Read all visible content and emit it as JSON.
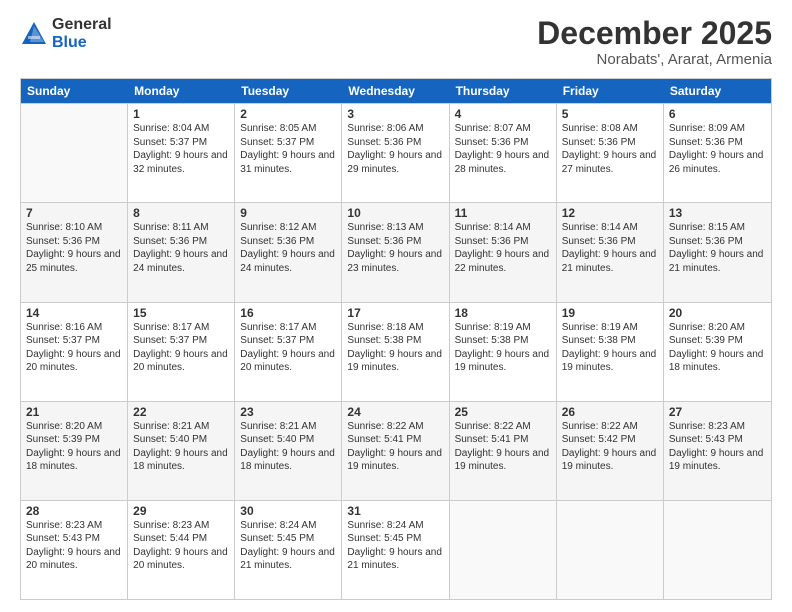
{
  "logo": {
    "general": "General",
    "blue": "Blue"
  },
  "title": "December 2025",
  "location": "Norabats', Ararat, Armenia",
  "days": [
    "Sunday",
    "Monday",
    "Tuesday",
    "Wednesday",
    "Thursday",
    "Friday",
    "Saturday"
  ],
  "weeks": [
    [
      {
        "day": "",
        "sunrise": "",
        "sunset": "",
        "daylight": ""
      },
      {
        "day": "1",
        "sunrise": "Sunrise: 8:04 AM",
        "sunset": "Sunset: 5:37 PM",
        "daylight": "Daylight: 9 hours and 32 minutes."
      },
      {
        "day": "2",
        "sunrise": "Sunrise: 8:05 AM",
        "sunset": "Sunset: 5:37 PM",
        "daylight": "Daylight: 9 hours and 31 minutes."
      },
      {
        "day": "3",
        "sunrise": "Sunrise: 8:06 AM",
        "sunset": "Sunset: 5:36 PM",
        "daylight": "Daylight: 9 hours and 29 minutes."
      },
      {
        "day": "4",
        "sunrise": "Sunrise: 8:07 AM",
        "sunset": "Sunset: 5:36 PM",
        "daylight": "Daylight: 9 hours and 28 minutes."
      },
      {
        "day": "5",
        "sunrise": "Sunrise: 8:08 AM",
        "sunset": "Sunset: 5:36 PM",
        "daylight": "Daylight: 9 hours and 27 minutes."
      },
      {
        "day": "6",
        "sunrise": "Sunrise: 8:09 AM",
        "sunset": "Sunset: 5:36 PM",
        "daylight": "Daylight: 9 hours and 26 minutes."
      }
    ],
    [
      {
        "day": "7",
        "sunrise": "Sunrise: 8:10 AM",
        "sunset": "Sunset: 5:36 PM",
        "daylight": "Daylight: 9 hours and 25 minutes."
      },
      {
        "day": "8",
        "sunrise": "Sunrise: 8:11 AM",
        "sunset": "Sunset: 5:36 PM",
        "daylight": "Daylight: 9 hours and 24 minutes."
      },
      {
        "day": "9",
        "sunrise": "Sunrise: 8:12 AM",
        "sunset": "Sunset: 5:36 PM",
        "daylight": "Daylight: 9 hours and 24 minutes."
      },
      {
        "day": "10",
        "sunrise": "Sunrise: 8:13 AM",
        "sunset": "Sunset: 5:36 PM",
        "daylight": "Daylight: 9 hours and 23 minutes."
      },
      {
        "day": "11",
        "sunrise": "Sunrise: 8:14 AM",
        "sunset": "Sunset: 5:36 PM",
        "daylight": "Daylight: 9 hours and 22 minutes."
      },
      {
        "day": "12",
        "sunrise": "Sunrise: 8:14 AM",
        "sunset": "Sunset: 5:36 PM",
        "daylight": "Daylight: 9 hours and 21 minutes."
      },
      {
        "day": "13",
        "sunrise": "Sunrise: 8:15 AM",
        "sunset": "Sunset: 5:36 PM",
        "daylight": "Daylight: 9 hours and 21 minutes."
      }
    ],
    [
      {
        "day": "14",
        "sunrise": "Sunrise: 8:16 AM",
        "sunset": "Sunset: 5:37 PM",
        "daylight": "Daylight: 9 hours and 20 minutes."
      },
      {
        "day": "15",
        "sunrise": "Sunrise: 8:17 AM",
        "sunset": "Sunset: 5:37 PM",
        "daylight": "Daylight: 9 hours and 20 minutes."
      },
      {
        "day": "16",
        "sunrise": "Sunrise: 8:17 AM",
        "sunset": "Sunset: 5:37 PM",
        "daylight": "Daylight: 9 hours and 20 minutes."
      },
      {
        "day": "17",
        "sunrise": "Sunrise: 8:18 AM",
        "sunset": "Sunset: 5:38 PM",
        "daylight": "Daylight: 9 hours and 19 minutes."
      },
      {
        "day": "18",
        "sunrise": "Sunrise: 8:19 AM",
        "sunset": "Sunset: 5:38 PM",
        "daylight": "Daylight: 9 hours and 19 minutes."
      },
      {
        "day": "19",
        "sunrise": "Sunrise: 8:19 AM",
        "sunset": "Sunset: 5:38 PM",
        "daylight": "Daylight: 9 hours and 19 minutes."
      },
      {
        "day": "20",
        "sunrise": "Sunrise: 8:20 AM",
        "sunset": "Sunset: 5:39 PM",
        "daylight": "Daylight: 9 hours and 18 minutes."
      }
    ],
    [
      {
        "day": "21",
        "sunrise": "Sunrise: 8:20 AM",
        "sunset": "Sunset: 5:39 PM",
        "daylight": "Daylight: 9 hours and 18 minutes."
      },
      {
        "day": "22",
        "sunrise": "Sunrise: 8:21 AM",
        "sunset": "Sunset: 5:40 PM",
        "daylight": "Daylight: 9 hours and 18 minutes."
      },
      {
        "day": "23",
        "sunrise": "Sunrise: 8:21 AM",
        "sunset": "Sunset: 5:40 PM",
        "daylight": "Daylight: 9 hours and 18 minutes."
      },
      {
        "day": "24",
        "sunrise": "Sunrise: 8:22 AM",
        "sunset": "Sunset: 5:41 PM",
        "daylight": "Daylight: 9 hours and 19 minutes."
      },
      {
        "day": "25",
        "sunrise": "Sunrise: 8:22 AM",
        "sunset": "Sunset: 5:41 PM",
        "daylight": "Daylight: 9 hours and 19 minutes."
      },
      {
        "day": "26",
        "sunrise": "Sunrise: 8:22 AM",
        "sunset": "Sunset: 5:42 PM",
        "daylight": "Daylight: 9 hours and 19 minutes."
      },
      {
        "day": "27",
        "sunrise": "Sunrise: 8:23 AM",
        "sunset": "Sunset: 5:43 PM",
        "daylight": "Daylight: 9 hours and 19 minutes."
      }
    ],
    [
      {
        "day": "28",
        "sunrise": "Sunrise: 8:23 AM",
        "sunset": "Sunset: 5:43 PM",
        "daylight": "Daylight: 9 hours and 20 minutes."
      },
      {
        "day": "29",
        "sunrise": "Sunrise: 8:23 AM",
        "sunset": "Sunset: 5:44 PM",
        "daylight": "Daylight: 9 hours and 20 minutes."
      },
      {
        "day": "30",
        "sunrise": "Sunrise: 8:24 AM",
        "sunset": "Sunset: 5:45 PM",
        "daylight": "Daylight: 9 hours and 21 minutes."
      },
      {
        "day": "31",
        "sunrise": "Sunrise: 8:24 AM",
        "sunset": "Sunset: 5:45 PM",
        "daylight": "Daylight: 9 hours and 21 minutes."
      },
      {
        "day": "",
        "sunrise": "",
        "sunset": "",
        "daylight": ""
      },
      {
        "day": "",
        "sunrise": "",
        "sunset": "",
        "daylight": ""
      },
      {
        "day": "",
        "sunrise": "",
        "sunset": "",
        "daylight": ""
      }
    ]
  ]
}
